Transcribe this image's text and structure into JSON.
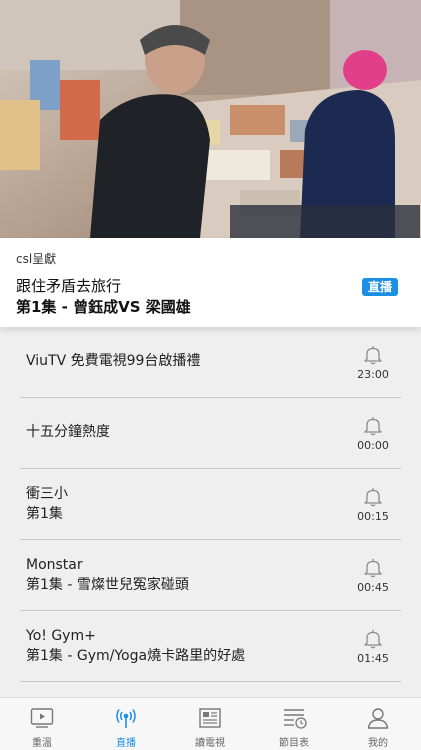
{
  "program": {
    "presenter": "csl呈獻",
    "title": "跟住矛盾去旅行",
    "episode": "第1集 - 曾鈺成VS 梁國雄",
    "badge": "直播"
  },
  "schedule": [
    {
      "title": "ViuTV 免費電視99台啟播禮",
      "subtitle": "",
      "time": "23:00"
    },
    {
      "title": "十五分鐘熱度",
      "subtitle": "",
      "time": "00:00"
    },
    {
      "title": "衝三小",
      "subtitle": "第1集",
      "time": "00:15"
    },
    {
      "title": "Monstar",
      "subtitle": "第1集 - 雪燦世兒冤家碰頭",
      "time": "00:45"
    },
    {
      "title": "Yo! Gym+",
      "subtitle": "第1集 - Gym/Yoga燒卡路里的好處",
      "time": "01:45"
    }
  ],
  "tabs": [
    {
      "label": "重溫",
      "icon": "replay-tv-icon"
    },
    {
      "label": "直播",
      "icon": "live-broadcast-icon",
      "active": true
    },
    {
      "label": "讀電視",
      "icon": "newspaper-icon"
    },
    {
      "label": "節目表",
      "icon": "schedule-icon"
    },
    {
      "label": "我的",
      "icon": "profile-icon"
    }
  ],
  "colors": {
    "accent": "#1a8fe3",
    "background": "#efefef"
  }
}
